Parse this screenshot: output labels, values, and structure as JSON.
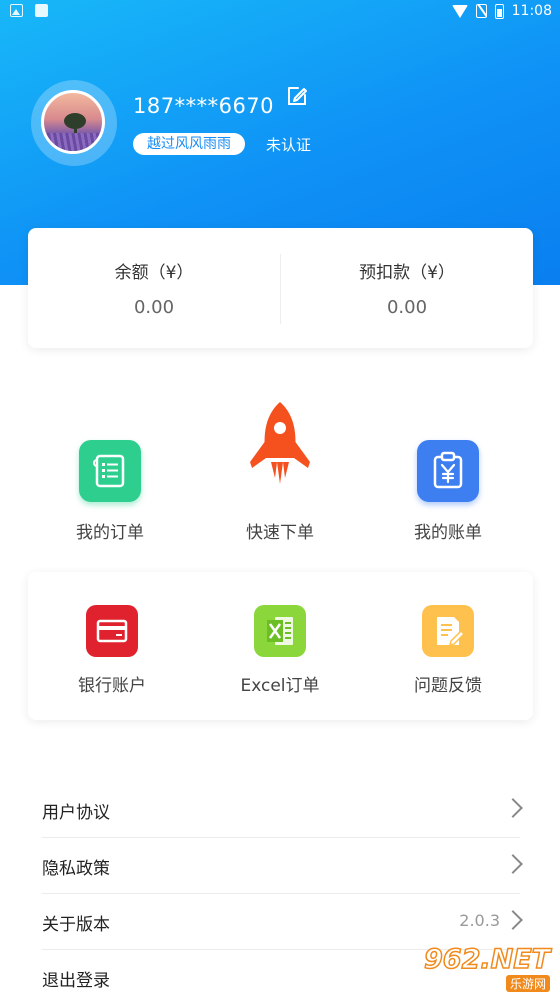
{
  "status_bar": {
    "time": "11:08"
  },
  "profile": {
    "phone": "187****6670",
    "nickname": "越过风风雨雨",
    "verify_status": "未认证"
  },
  "balance": {
    "balance_label": "余额（¥）",
    "balance_value": "0.00",
    "prepaid_label": "预扣款（¥）",
    "prepaid_value": "0.00"
  },
  "actions": {
    "my_orders": "我的订单",
    "quick_order": "快速下单",
    "my_bills": "我的账单"
  },
  "grid": {
    "bank_account": "银行账户",
    "excel_order": "Excel订单",
    "feedback": "问题反馈"
  },
  "menu": {
    "user_agreement": "用户协议",
    "privacy_policy": "隐私政策",
    "about_version": "关于版本",
    "version_value": "2.0.3",
    "logout": "退出登录"
  },
  "watermark": {
    "main": "962.NET",
    "sub": "乐游网"
  },
  "colors": {
    "header_blue": "#0f92f6",
    "orders_green": "#2ecf8e",
    "rocket_orange": "#f4511e",
    "bills_blue": "#3d7ef0",
    "bank_red": "#e0222e",
    "excel_green": "#8bd63a",
    "feedback_yellow": "#ffc14d"
  }
}
